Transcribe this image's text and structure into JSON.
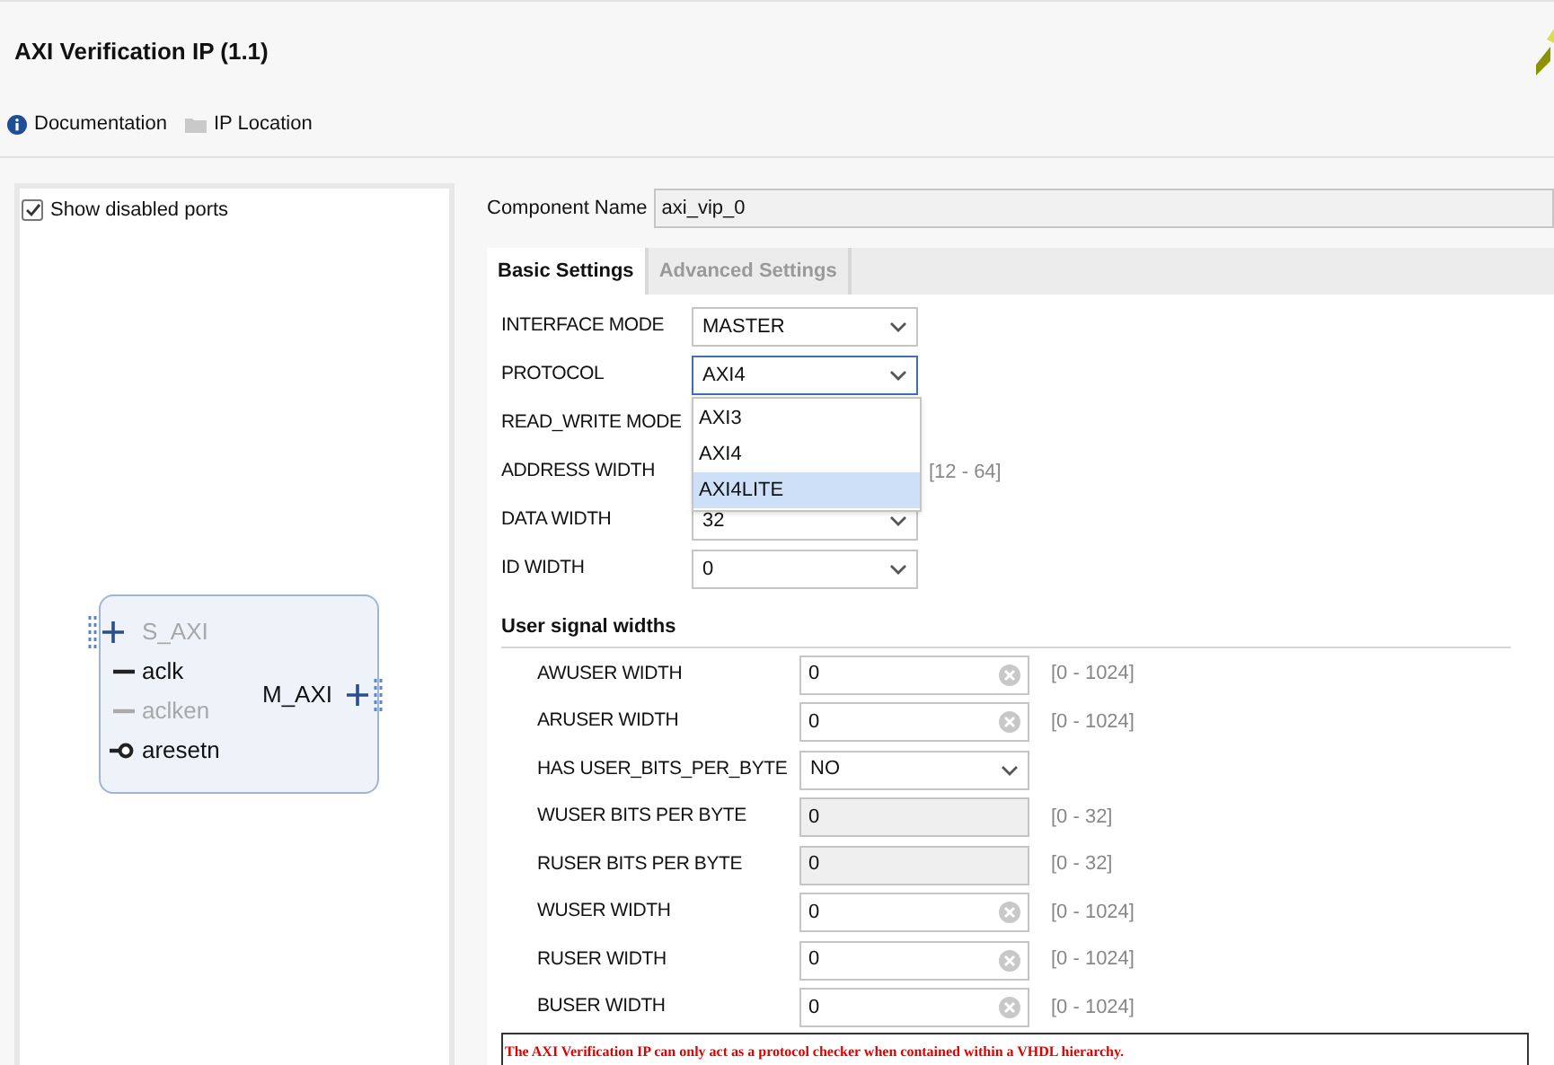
{
  "window": {
    "title": "AXI Verification IP (1.1)"
  },
  "toolbar": [
    {
      "label": "Documentation",
      "kind": "info"
    },
    {
      "label": "IP Location",
      "kind": "folder"
    }
  ],
  "symbol_panel": {
    "show_disabled_ports": {
      "label": "Show disabled ports",
      "checked": true
    },
    "block": {
      "left_ports": [
        {
          "name": "S_AXI",
          "kind": "bus",
          "enabled": false
        },
        {
          "name": "aclk",
          "kind": "clock",
          "enabled": true
        },
        {
          "name": "aclken",
          "kind": "clock",
          "enabled": false
        },
        {
          "name": "aresetn",
          "kind": "reset",
          "enabled": true
        }
      ],
      "right_ports": [
        {
          "name": "M_AXI",
          "kind": "bus",
          "enabled": true
        }
      ]
    }
  },
  "component_name": {
    "label": "Component Name",
    "value": "axi_vip_0"
  },
  "tabs": [
    {
      "label": "Basic Settings",
      "selected": true
    },
    {
      "label": "Advanced Settings",
      "selected": false
    }
  ],
  "basic_params": [
    {
      "label": "INTERFACE MODE",
      "kind": "select",
      "value": "MASTER"
    },
    {
      "label": "PROTOCOL",
      "kind": "select",
      "value": "AXI4",
      "focused": true
    },
    {
      "label": "READ_WRITE MODE",
      "kind": "covered"
    },
    {
      "label": "ADDRESS WIDTH",
      "kind": "covered",
      "range": "[12 - 64]"
    },
    {
      "label": "DATA WIDTH",
      "kind": "select",
      "value": "32"
    },
    {
      "label": "ID WIDTH",
      "kind": "select",
      "value": "0"
    }
  ],
  "protocol_dropdown": [
    {
      "label": "AXI3",
      "selected": false
    },
    {
      "label": "AXI4",
      "selected": false
    },
    {
      "label": "AXI4LITE",
      "selected": true
    }
  ],
  "user_signal_widths": {
    "title": "User signal widths",
    "params": [
      {
        "label": "AWUSER WIDTH",
        "kind": "text",
        "value": "0",
        "range": "[0 - 1024]"
      },
      {
        "label": "ARUSER WIDTH",
        "kind": "text",
        "value": "0",
        "range": "[0 - 1024]"
      },
      {
        "label": "HAS USER_BITS_PER_BYTE",
        "kind": "select",
        "value": "NO"
      },
      {
        "label": "WUSER BITS PER BYTE",
        "kind": "disabled",
        "value": "0",
        "range": "[0 - 32]"
      },
      {
        "label": "RUSER BITS PER BYTE",
        "kind": "disabled",
        "value": "0",
        "range": "[0 - 32]"
      },
      {
        "label": "WUSER WIDTH",
        "kind": "text",
        "value": "0",
        "range": "[0 - 1024]"
      },
      {
        "label": "RUSER WIDTH",
        "kind": "text",
        "value": "0",
        "range": "[0 - 1024]"
      },
      {
        "label": "BUSER WIDTH",
        "kind": "text",
        "value": "0",
        "range": "[0 - 1024]"
      }
    ]
  },
  "warning": "The AXI Verification IP can only act as a protocol checker when contained within a VHDL hierarchy."
}
